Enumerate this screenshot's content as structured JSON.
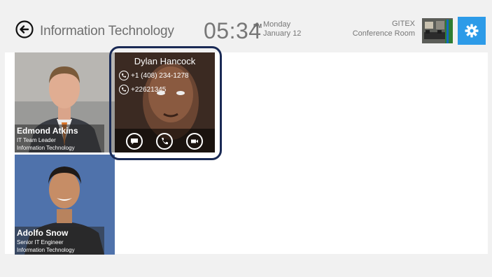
{
  "caption": "",
  "header": {
    "title": "Information Technology",
    "time": "05:34",
    "ampm": "PM",
    "day": "Monday",
    "date": "January 12",
    "room_name": "GITEX",
    "room_type": "Conference Room"
  },
  "contacts": [
    {
      "name": "Edmond Atkins",
      "role": "IT Team Leader",
      "dept": "Information Technology"
    },
    {
      "name": "Adolfo Snow",
      "role": "Senior IT Engineer",
      "dept": "Information Technology"
    }
  ],
  "focused_contact": {
    "name": "Dylan Hancock",
    "phones": [
      "+1 (408) 234-1278",
      "+22621345"
    ],
    "actions": [
      "chat-icon",
      "phone-icon",
      "video-icon"
    ]
  },
  "colors": {
    "accent": "#2d9be8",
    "focus_ring": "#1a2a55",
    "panel": "#ffffff",
    "background": "#f1f1f1"
  }
}
